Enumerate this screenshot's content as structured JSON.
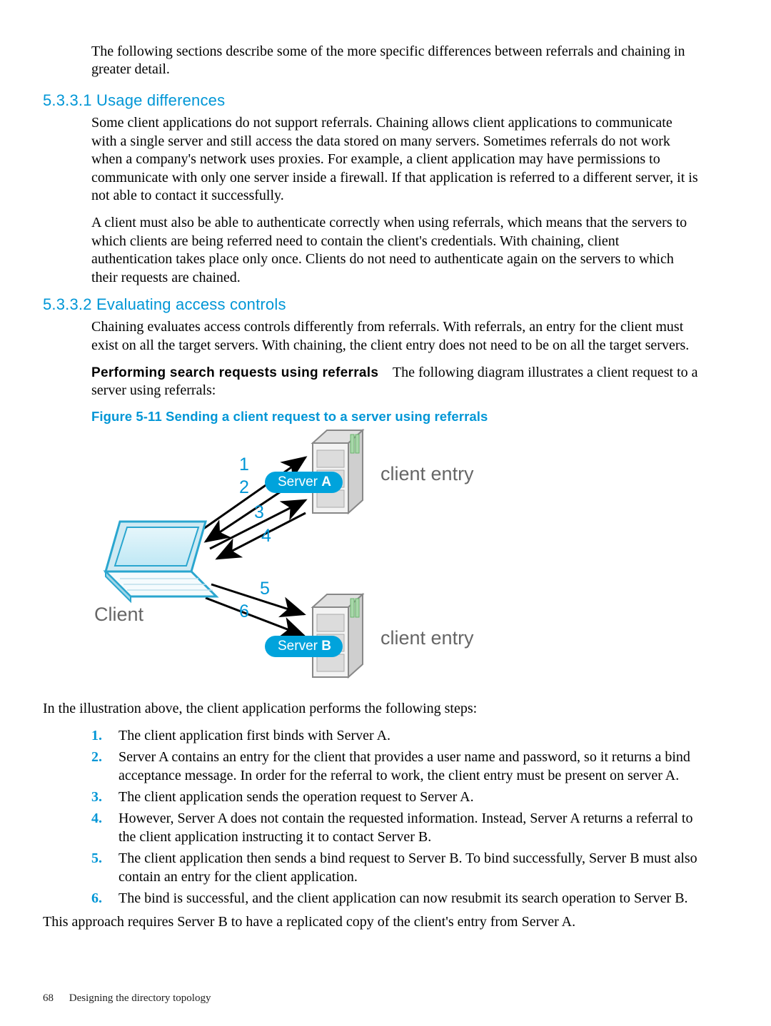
{
  "intro": "The following sections describe some of the more specific differences between referrals and chaining in greater detail.",
  "section1": {
    "heading": "5.3.3.1 Usage differences",
    "p1": "Some client applications do not support referrals. Chaining allows client applications to communicate with a single server and still access the data stored on many servers. Sometimes referrals do not work when a company's network uses proxies. For example, a client application may have permissions to communicate with only one server inside a firewall. If that application is referred to a different server, it is not able to contact it successfully.",
    "p2": "A client must also be able to authenticate correctly when using referrals, which means that the servers to which clients are being referred need to contain the client's credentials. With chaining, client authentication takes place only once. Clients do not need to authenticate again on the servers to which their requests are chained."
  },
  "section2": {
    "heading": "5.3.3.2 Evaluating access controls",
    "p1": "Chaining evaluates access controls differently from referrals. With referrals, an entry for the client must exist on all the target servers. With chaining, the client entry does not need to be on all the target servers.",
    "runin": "Performing search requests using referrals",
    "runin_body": "The following diagram illustrates a client request to a server using referrals:"
  },
  "figure": {
    "caption": "Figure 5-11 Sending a client request to a server using referrals",
    "client_label": "Client",
    "server_a_prefix": "Server ",
    "server_a_letter": "A",
    "server_b_prefix": "Server ",
    "server_b_letter": "B",
    "client_entry": "client entry",
    "steps": [
      "1",
      "2",
      "3",
      "4",
      "5",
      "6"
    ]
  },
  "after_figure": "In the illustration above, the client application performs the following steps:",
  "steps": [
    "The client application first binds with Server A.",
    "Server A contains an entry for the client that provides a user name and password, so it returns a bind acceptance message. In order for the referral to work, the client entry must be present on server A.",
    "The client application sends the operation request to Server A.",
    "However, Server A does not contain the requested information. Instead, Server A returns a referral to the client application instructing it to contact Server B.",
    "The client application then sends a bind request to Server B. To bind successfully, Server B must also contain an entry for the client application.",
    "The bind is successful, and the client application can now resubmit its search operation to Server B."
  ],
  "closing": "This approach requires Server B to have a replicated copy of the client's entry from Server A.",
  "footer": {
    "page": "68",
    "title": "Designing the directory topology"
  }
}
